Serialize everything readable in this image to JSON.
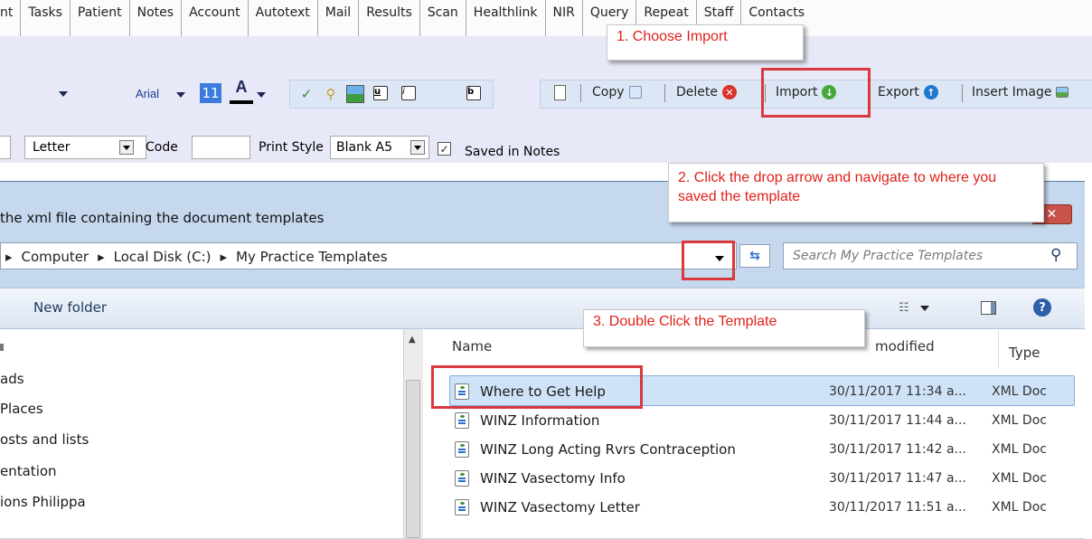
{
  "menubar": {
    "items": [
      "nt",
      "Tasks",
      "Patient",
      "Notes",
      "Account",
      "Autotext",
      "Mail",
      "Results",
      "Scan",
      "Healthlink",
      "NIR",
      "Query",
      "Repeat",
      "Staff",
      "Contacts"
    ]
  },
  "toolbar": {
    "font_name": "Arial",
    "font_size": "11",
    "font_color_label": "A",
    "underline_label": "u",
    "italic_label": "i",
    "bold_label": "b",
    "copy_label": "Copy",
    "delete_label": "Delete",
    "import_label": "Import",
    "export_label": "Export",
    "insert_image_label": "Insert Image"
  },
  "properties": {
    "letter_value": "Letter",
    "code_label": "Code",
    "code_value": "",
    "print_style_label": "Print Style",
    "print_style_value": "Blank A5",
    "saved_in_notes_label": "Saved in Notes",
    "saved_in_notes_checked": true
  },
  "callouts": {
    "step1": "1. Choose Import",
    "step2": "2. Click the drop arrow and navigate to where you saved the template",
    "step3": "3. Double Click the Template"
  },
  "dialog": {
    "title": "the xml file containing the document templates",
    "breadcrumb": [
      "Computer",
      "Local Disk (C:)",
      "My Practice Templates"
    ],
    "search_placeholder": "Search My Practice Templates",
    "new_folder_label": "New folder",
    "nav_items": [
      "ads",
      "Places",
      "osts and lists",
      "entation",
      "ions Philippa"
    ],
    "columns": {
      "name": "Name",
      "modified": "modified",
      "type": "Type"
    },
    "files": [
      {
        "name": "Where to Get Help",
        "date": "30/11/2017 11:34 a...",
        "type": "XML Doc"
      },
      {
        "name": "WINZ Information",
        "date": "30/11/2017 11:44 a...",
        "type": "XML Doc"
      },
      {
        "name": "WINZ Long Acting Rvrs Contraception",
        "date": "30/11/2017 11:42 a...",
        "type": "XML Doc"
      },
      {
        "name": "WINZ Vasectomy Info",
        "date": "30/11/2017 11:47 a...",
        "type": "XML Doc"
      },
      {
        "name": "WINZ Vasectomy Letter",
        "date": "30/11/2017 11:51 a...",
        "type": "XML Doc"
      }
    ]
  }
}
